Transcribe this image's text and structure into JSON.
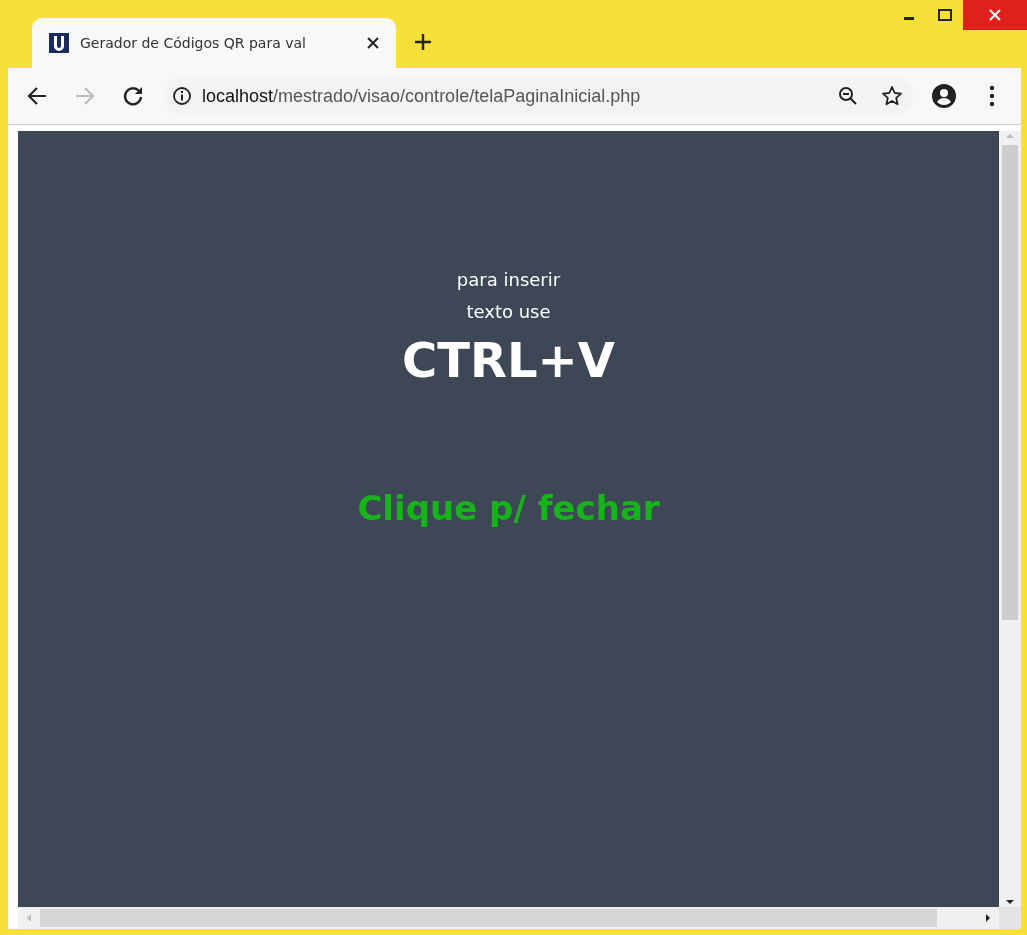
{
  "tab": {
    "title": "Gerador de Códigos QR para val",
    "selected": true
  },
  "address": {
    "host": "localhost",
    "path": "/mestrado/visao/controle/telaPaginaInicial.php"
  },
  "page": {
    "lines": [
      "para inserir",
      "texto use"
    ],
    "shortcut": "CTRL+V",
    "close_link": "Clique p/ fechar"
  }
}
